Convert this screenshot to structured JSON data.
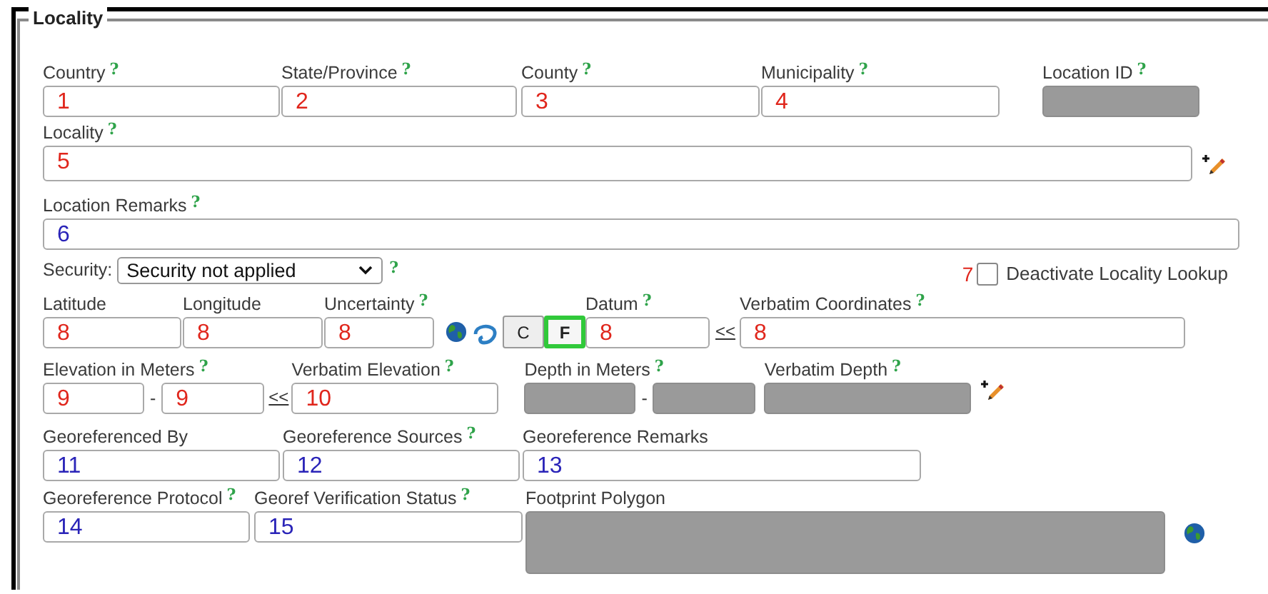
{
  "legend": "Locality",
  "place_fields": [
    {
      "label": "Country",
      "help": "?",
      "value": "1",
      "color": "#e0261c",
      "disabled": false
    },
    {
      "label": "State/Province",
      "help": "?",
      "value": "2",
      "color": "#e0261c",
      "disabled": false
    },
    {
      "label": "County",
      "help": "?",
      "value": "3",
      "color": "#e0261c",
      "disabled": false
    },
    {
      "label": "Municipality",
      "help": "?",
      "value": "4",
      "color": "#e0261c",
      "disabled": false
    },
    {
      "label": "Location ID",
      "help": "?",
      "disabled": true
    }
  ],
  "locality": {
    "label": "Locality",
    "help": "?",
    "value": "5",
    "color": "#e0261c",
    "disabled": false
  },
  "remarks": {
    "label": "Location Remarks",
    "help": "?",
    "value": "6",
    "color": "#2a24b8",
    "disabled": false
  },
  "security": {
    "label": "Security:",
    "value": "Security not applied",
    "help": "?"
  },
  "lookup": {
    "marker": "7",
    "label": "Deactivate Locality Lookup",
    "checked": false
  },
  "coordinates": [
    {
      "label": "Latitude",
      "value": "8",
      "color": "#e0261c",
      "disabled": false
    },
    {
      "label": "Longitude",
      "value": "8",
      "color": "#e0261c",
      "disabled": false
    },
    {
      "label": "Uncertainty",
      "help": "?",
      "value": "8",
      "color": "#e0261c",
      "disabled": false
    }
  ],
  "units": [
    {
      "label": "C",
      "selected": false
    },
    {
      "label": "F",
      "selected": true
    }
  ],
  "datum": {
    "label": "Datum",
    "help": "?",
    "value": "8",
    "color": "#e0261c",
    "disabled": false
  },
  "coordinates_copy": "<<",
  "verbatim_coordinates": {
    "label": "Verbatim Coordinates",
    "help": "?",
    "value": "8",
    "color": "#e0261c",
    "disabled": false
  },
  "elevation": {
    "label": "Elevation in Meters",
    "help": "?",
    "separator": "-",
    "from": {
      "value": "9",
      "color": "#e0261c",
      "disabled": false
    },
    "to": {
      "value": "9",
      "color": "#e0261c",
      "disabled": false
    }
  },
  "elevation_copy": "<<",
  "verbatim_elevation": {
    "label": "Verbatim Elevation",
    "help": "?",
    "value": "10",
    "color": "#e0261c",
    "disabled": false
  },
  "depth": {
    "label": "Depth in Meters",
    "help": "?",
    "separator": "-",
    "from": {
      "disabled": true
    },
    "to": {
      "disabled": true
    }
  },
  "verbatim_depth": {
    "label": "Verbatim Depth",
    "help": "?",
    "disabled": true
  },
  "georef_row_1": [
    {
      "label": "Georeferenced By",
      "value": "11",
      "color": "#2a24b8",
      "disabled": false
    },
    {
      "label": "Georeference Sources",
      "help": "?",
      "value": "12",
      "color": "#2a24b8",
      "disabled": false
    },
    {
      "label": "Georeference Remarks",
      "value": "13",
      "color": "#2a24b8",
      "disabled": false
    }
  ],
  "georef_row_2": [
    {
      "label": "Georeference Protocol",
      "help": "?",
      "value": "14",
      "color": "#2a24b8",
      "disabled": false
    },
    {
      "label": "Georef Verification Status",
      "help": "?",
      "value": "15",
      "color": "#2a24b8",
      "disabled": false
    }
  ],
  "footprint": {
    "label": "Footprint Polygon",
    "disabled": true
  }
}
